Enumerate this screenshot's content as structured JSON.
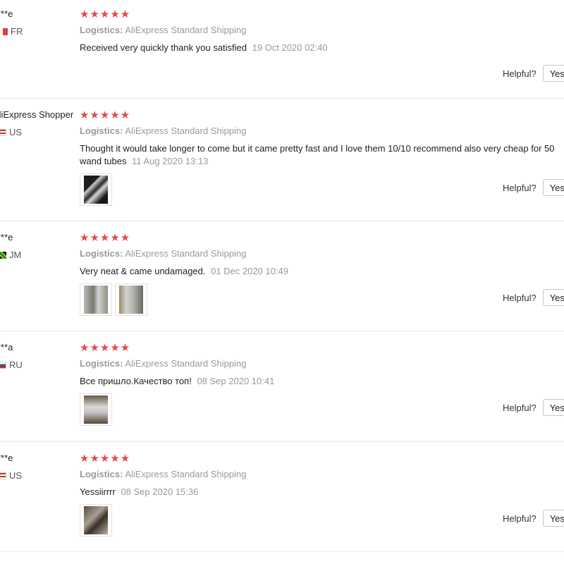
{
  "helpful_label": "Helpful?",
  "yes_label": "Yes",
  "logistics_label": "Logistics:",
  "reviews": [
    {
      "user": "***e",
      "country": "FR",
      "stars": "★★★★★",
      "logistics": "AliExpress Standard Shipping",
      "text": "Received very quickly thank you satisfied",
      "date": "19 Oct 2020 02:40"
    },
    {
      "user": "AliExpress Shopper",
      "country": "US",
      "stars": "★★★★★",
      "logistics": "AliExpress Standard Shipping",
      "text": "Thought it would take longer to come but it came pretty fast and I love them 10/10 recommend also very cheap for 50 wand tubes",
      "date": "11 Aug 2020 13:13"
    },
    {
      "user": "***e",
      "country": "JM",
      "stars": "★★★★★",
      "logistics": "AliExpress Standard Shipping",
      "text": "Very neat & came undamaged.",
      "date": "01 Dec 2020 10:49"
    },
    {
      "user": "***a",
      "country": "RU",
      "stars": "★★★★★",
      "logistics": "AliExpress Standard Shipping",
      "text": "Все пришло.Качество топ!",
      "date": "08 Sep 2020 10:41"
    },
    {
      "user": "***e",
      "country": "US",
      "stars": "★★★★★",
      "logistics": "AliExpress Standard Shipping",
      "text": "Yessiirrrr",
      "date": "08 Sep 2020 15:36"
    }
  ],
  "colors": {
    "star": "#e5484d",
    "muted": "#9a9a9a",
    "divider": "#e8e8e8"
  }
}
